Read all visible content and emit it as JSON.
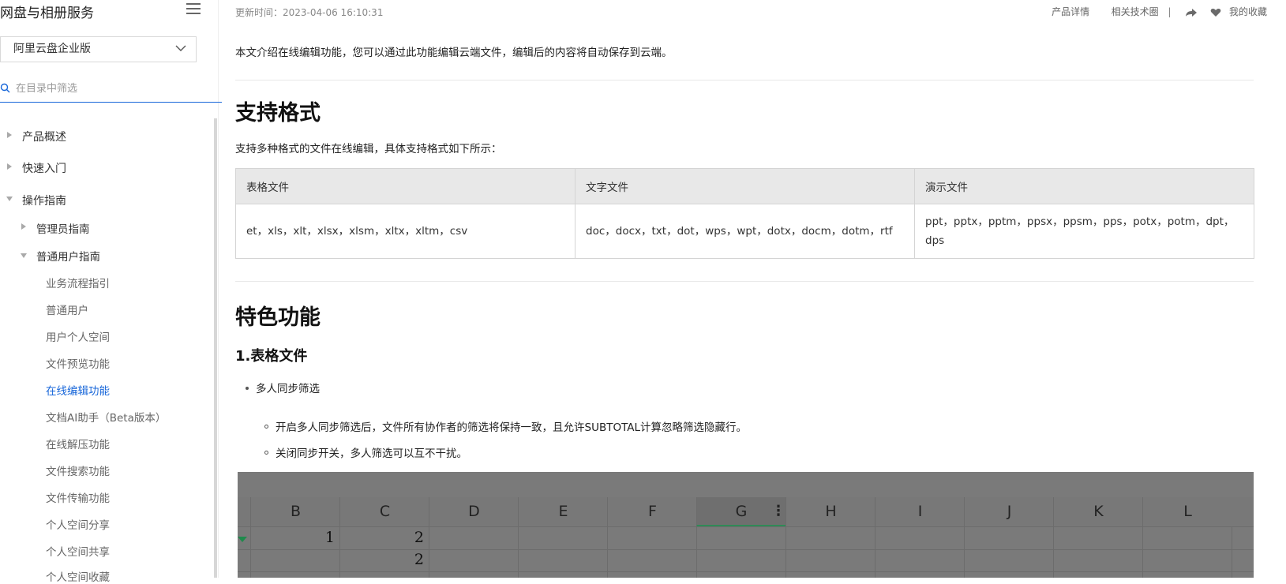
{
  "sidebar": {
    "title": "网盘与相册服务",
    "product_select": "阿里云盘企业版",
    "filter_placeholder": "在目录中筛选",
    "items": [
      {
        "label": "产品概述"
      },
      {
        "label": "快速入门"
      },
      {
        "label": "操作指南"
      },
      {
        "label": "管理员指南"
      },
      {
        "label": "普通用户指南"
      },
      {
        "label": "业务流程指引"
      },
      {
        "label": "普通用户"
      },
      {
        "label": "用户个人空间"
      },
      {
        "label": "文件预览功能"
      },
      {
        "label": "在线编辑功能"
      },
      {
        "label": "文档AI助手（Beta版本）"
      },
      {
        "label": "在线解压功能"
      },
      {
        "label": "文件搜索功能"
      },
      {
        "label": "文件传输功能"
      },
      {
        "label": "个人空间分享"
      },
      {
        "label": "个人空间共享"
      },
      {
        "label": "个人空间收藏"
      }
    ]
  },
  "meta": {
    "updated": "更新时间：2023-04-06 16:10:31",
    "links": {
      "product_detail": "产品详情",
      "tech_circle": "相关技术圈",
      "favorites": "我的收藏"
    }
  },
  "content": {
    "intro": "本文介绍在线编辑功能，您可以通过此功能编辑云端文件，编辑后的内容将自动保存到云端。",
    "h_formats": "支持格式",
    "formats_desc": "支持多种格式的文件在线编辑，具体支持格式如下所示：",
    "table": {
      "headers": [
        "表格文件",
        "文字文件",
        "演示文件"
      ],
      "row": [
        "et，xls，xlt，xlsx，xlsm，xltx，xltm，csv",
        "doc，docx，txt，dot，wps，wpt，dotx，docm，dotm，rtf",
        "ppt，pptx，pptm，ppsx，ppsm，pps，potx，potm，dpt，dps"
      ]
    },
    "h_features": "特色功能",
    "h_sheet": "1.表格文件",
    "bullet_1": "多人同步筛选",
    "sub_1": "开启多人同步筛选后，文件所有协作者的筛选将保持一致，且允许SUBTOTAL计算忽略筛选隐藏行。",
    "sub_2": "关闭同步开关，多人筛选可以互不干扰。"
  },
  "sheet": {
    "columns": [
      "B",
      "C",
      "D",
      "E",
      "F",
      "G",
      "H",
      "I",
      "J",
      "K",
      "L"
    ],
    "cells": [
      "1",
      "2",
      "2"
    ],
    "selected_column": "G"
  },
  "icons": {
    "menu": "hamburger-menu-icon",
    "select": "chevron-down-icon",
    "filter": "search-icon",
    "share": "share-arrow-icon",
    "favorite": "heart-icon"
  },
  "colors": {
    "accent": "#1766d9",
    "sheet_selection": "#2f8a57"
  }
}
